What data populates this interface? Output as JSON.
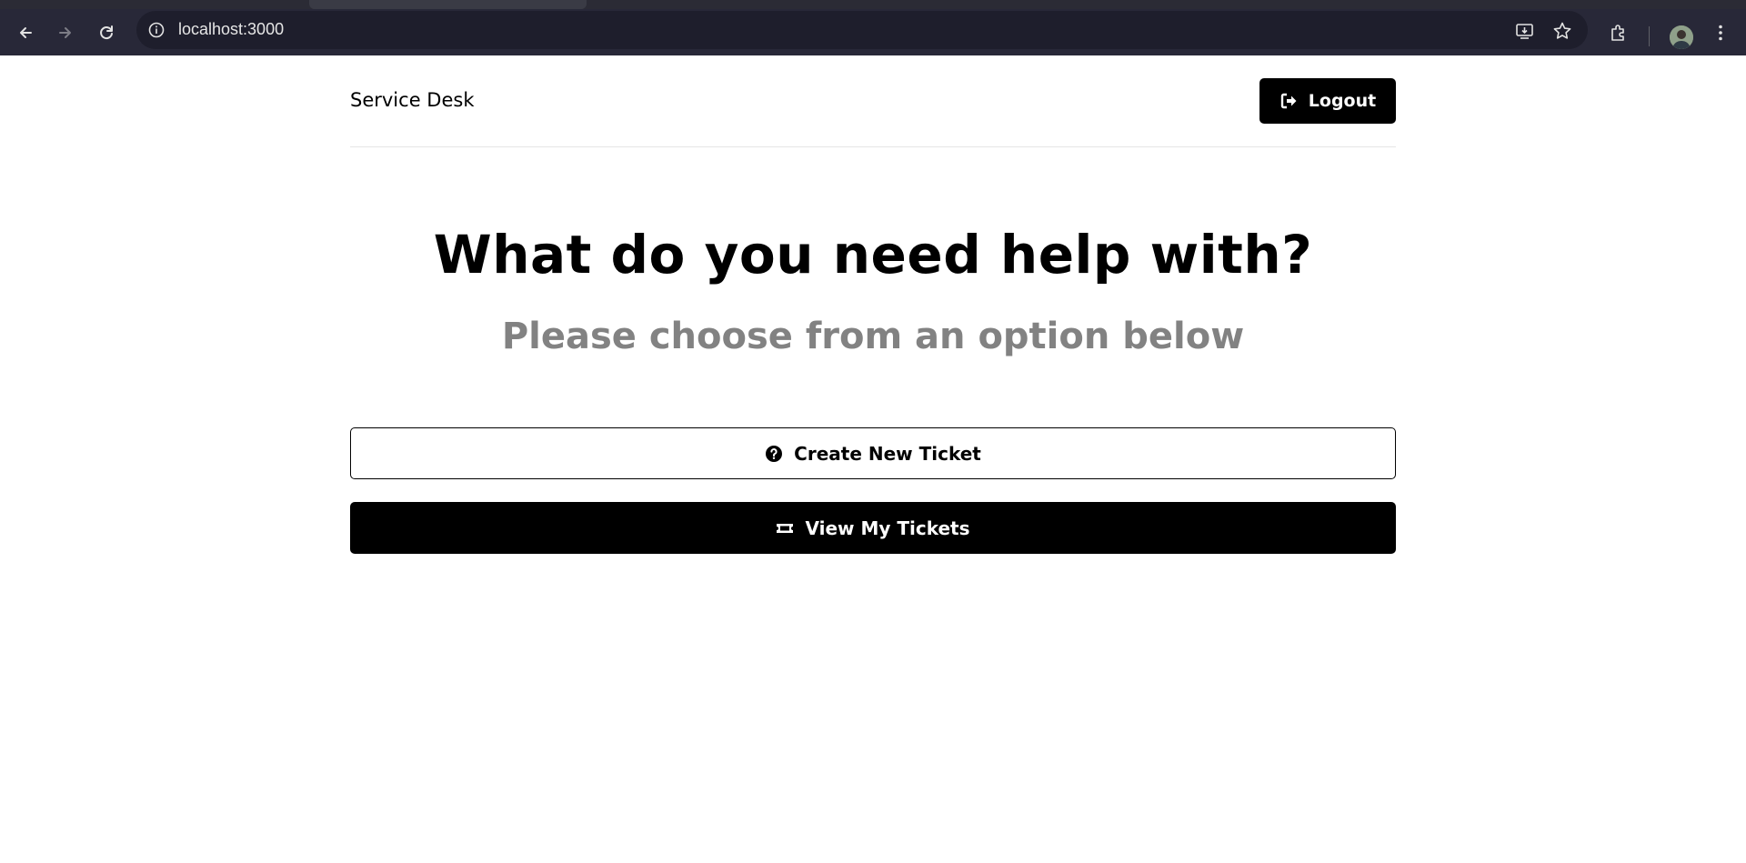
{
  "browser": {
    "url": "localhost:3000",
    "icons": [
      "back-arrow-icon",
      "forward-arrow-icon",
      "reload-icon",
      "site-info-icon",
      "install-app-icon",
      "bookmark-star-icon",
      "extensions-icon",
      "profile-avatar",
      "more-menu-icon"
    ]
  },
  "header": {
    "brand": "Service Desk",
    "logout_label": "Logout"
  },
  "main": {
    "heading": "What do you need help with?",
    "subheading": "Please choose from an option below",
    "create_ticket_label": "Create New Ticket",
    "view_tickets_label": "View My Tickets"
  },
  "colors": {
    "chrome_background": "#282838",
    "omnibox_background": "#1e1e2c",
    "primary": "#000000",
    "subheading": "#828282",
    "page_background": "#ffffff"
  }
}
